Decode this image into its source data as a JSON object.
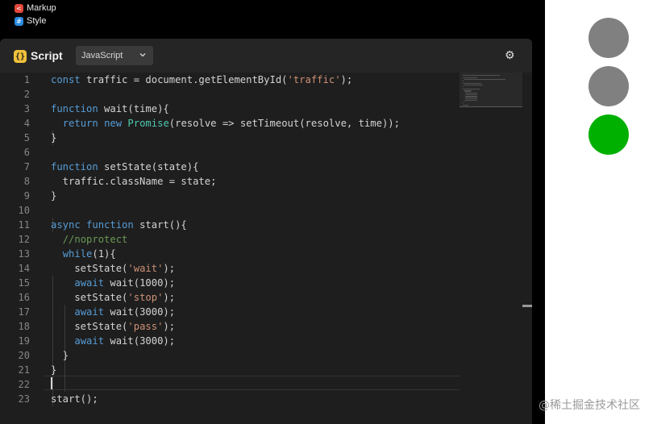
{
  "tabs": {
    "markup": {
      "label": "Markup",
      "icon": "html-icon"
    },
    "style": {
      "label": "Style",
      "icon": "css-icon"
    }
  },
  "editor": {
    "title": "Script",
    "language": "JavaScript",
    "lines": [
      "const traffic = document.getElementById('traffic');",
      "",
      "function wait(time){",
      "  return new Promise(resolve => setTimeout(resolve, time));",
      "}",
      "",
      "function setState(state){",
      "  traffic.className = state;",
      "}",
      "",
      "async function start(){",
      "  //noprotect",
      "  while(1){",
      "    setState('wait');",
      "    await wait(1000);",
      "    setState('stop');",
      "    await wait(3000);",
      "    setState('pass');",
      "    await wait(3000);",
      "  }",
      "}",
      "",
      "start();"
    ],
    "line_numbers": [
      "1",
      "2",
      "3",
      "4",
      "5",
      "6",
      "7",
      "8",
      "9",
      "10",
      "11",
      "12",
      "13",
      "14",
      "15",
      "16",
      "17",
      "18",
      "19",
      "20",
      "21",
      "22",
      "23"
    ]
  },
  "preview": {
    "lights": [
      {
        "name": "light-top",
        "color": "#808080"
      },
      {
        "name": "light-middle",
        "color": "#808080"
      },
      {
        "name": "light-bottom",
        "color": "#00b000"
      }
    ]
  },
  "watermark": "@稀土掘金技术社区",
  "colors": {
    "keyword": "#569cd6",
    "string": "#ce9178",
    "comment": "#6a9955",
    "type": "#4ec9b0",
    "number": "#b5cea8"
  }
}
